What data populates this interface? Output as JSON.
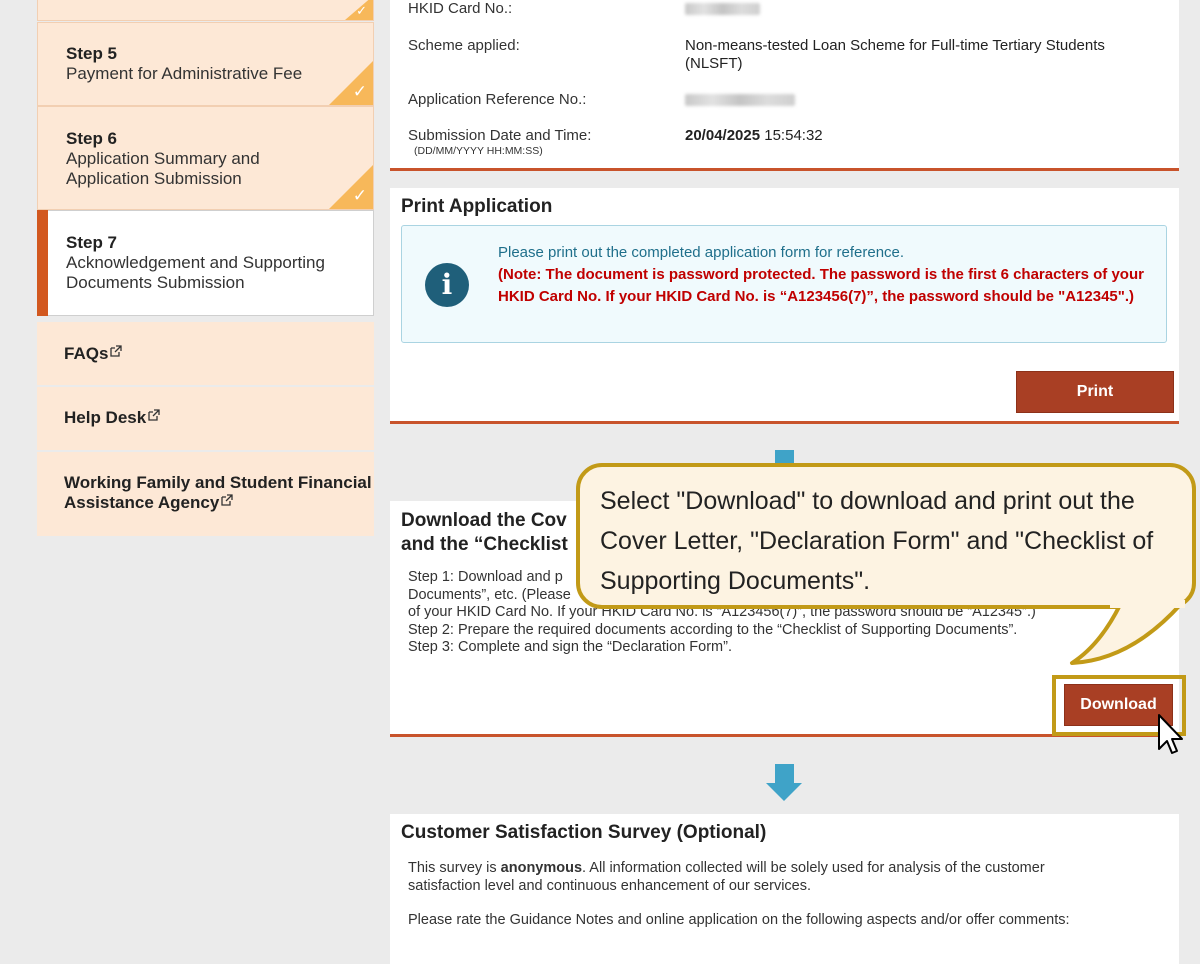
{
  "sidebar": {
    "steps": [
      {
        "title": "Step 5",
        "desc": "Payment for Administrative Fee",
        "done": true
      },
      {
        "title": "Step 6",
        "desc": "Application Summary and Application Submission",
        "done": true
      },
      {
        "title": "Step 7",
        "desc": "Acknowledgement and Supporting Documents Submission",
        "done": false,
        "active": true
      }
    ],
    "links": [
      {
        "label": "FAQs"
      },
      {
        "label": "Help Desk"
      },
      {
        "label": "Working Family and Student Financial Assistance Agency"
      }
    ]
  },
  "summary": {
    "hkid_label": "HKID Card No.:",
    "scheme_label": "Scheme applied:",
    "scheme_value": "Non-means-tested Loan Scheme for Full-time Tertiary Students (NLSFT)",
    "ref_label": "Application Reference No.:",
    "date_label": "Submission Date and Time:",
    "date_format": "(DD/MM/YYYY HH:MM:SS)",
    "date_value": "20/04/2025",
    "time_value": "15:54:32"
  },
  "print_section": {
    "title": "Print Application",
    "info_line": "Please print out the completed application form for reference.",
    "note": "(Note: The document is password protected. The password is the first 6 characters of your HKID Card No. If your HKID Card No. is “A123456(7)”, the password should be \"A12345\".)",
    "button": "Print"
  },
  "download_section": {
    "title_line1": "Download the Cov",
    "title_line2": "and the “Checklist",
    "step1_a": "Step 1: Download and p",
    "step1_b": "Documents”, etc. (Please",
    "step1_c": "of your HKID Card No. If your HKID Card No. is “A123456(7)”, the password should be “A12345”.)",
    "step2": "Step 2: Prepare the required documents according to the “Checklist of Supporting Documents”.",
    "step3": "Step 3: Complete and sign the “Declaration Form”.",
    "button": "Download"
  },
  "survey_section": {
    "title": "Customer Satisfaction Survey (Optional)",
    "line1_a": "This survey is ",
    "line1_bold": "anonymous",
    "line1_b": ". All information collected will be solely used for analysis of the customer satisfaction level and continuous enhancement of our services.",
    "line2": "Please rate the Guidance Notes and online application on the following aspects and/or offer comments:"
  },
  "callout": {
    "text": "Select \"Download\" to download and print out the Cover Letter, \"Declaration Form\" and \"Checklist of Supporting Documents\"."
  },
  "colors": {
    "accent": "#c8532b",
    "button": "#a93f24",
    "callout_border": "#c29a17",
    "sidebar_bg": "#fde8d6",
    "arrow": "#3fa3c8"
  }
}
